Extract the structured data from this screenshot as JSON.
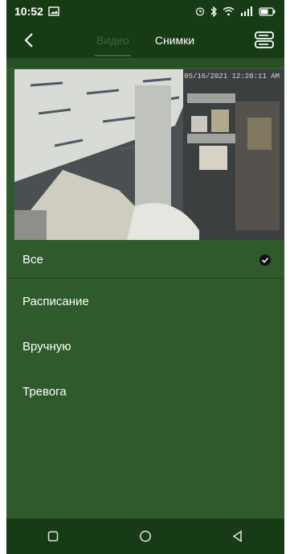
{
  "status_bar": {
    "time": "10:52",
    "icons": [
      "gallery-icon",
      "alarm-icon",
      "bluetooth-icon",
      "wifi-icon",
      "signal-icon",
      "battery-icon"
    ]
  },
  "header": {
    "tabs": [
      {
        "label": "Видео",
        "state": "inactive"
      },
      {
        "label": "Снимки",
        "state": "active"
      }
    ]
  },
  "video": {
    "timestamp": "05/16/2021 12:20:11 AM"
  },
  "filter_list": {
    "items": [
      {
        "label": "Все",
        "selected": true
      },
      {
        "label": "Расписание",
        "selected": false
      },
      {
        "label": "Вручную",
        "selected": false
      },
      {
        "label": "Тревога",
        "selected": false
      }
    ]
  },
  "colors": {
    "app_bar": "#173b15",
    "content": "#2f5a2c",
    "text": "#ffffff",
    "inactive_tab": "#41633e"
  }
}
